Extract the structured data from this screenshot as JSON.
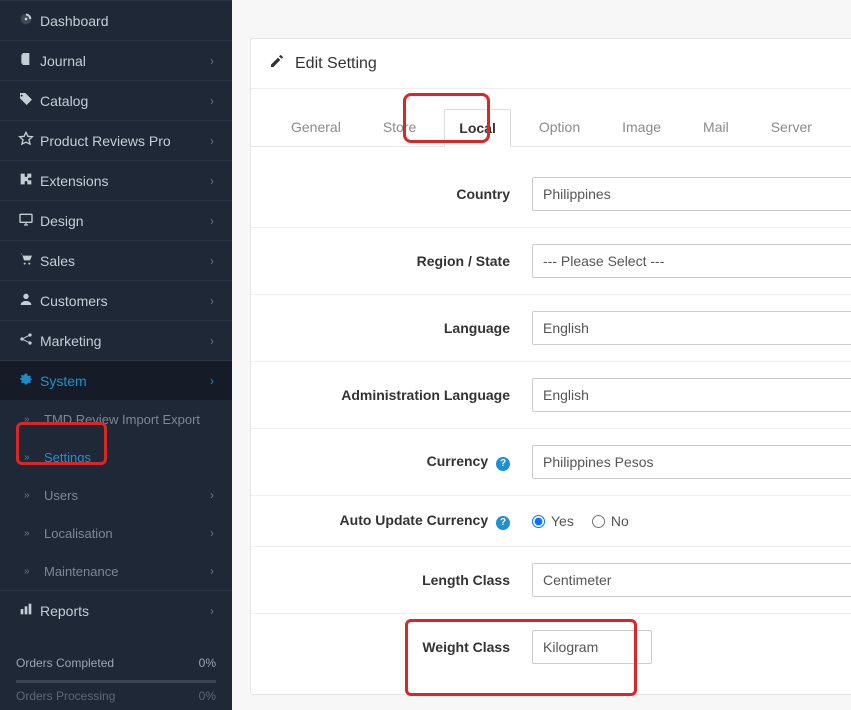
{
  "sidebar": {
    "items": [
      {
        "icon": "dashboard",
        "label": "Dashboard",
        "chevron": false
      },
      {
        "icon": "journal",
        "label": "Journal",
        "chevron": true
      },
      {
        "icon": "tag",
        "label": "Catalog",
        "chevron": true
      },
      {
        "icon": "star",
        "label": "Product Reviews Pro",
        "chevron": true
      },
      {
        "icon": "puzzle",
        "label": "Extensions",
        "chevron": true
      },
      {
        "icon": "monitor",
        "label": "Design",
        "chevron": true
      },
      {
        "icon": "cart",
        "label": "Sales",
        "chevron": true
      },
      {
        "icon": "user",
        "label": "Customers",
        "chevron": true
      },
      {
        "icon": "share",
        "label": "Marketing",
        "chevron": true
      },
      {
        "icon": "gear",
        "label": "System",
        "chevron": true,
        "active": true
      }
    ],
    "system_submenu": [
      {
        "label": "TMD Review Import Export",
        "chevron": false
      },
      {
        "label": "Settings",
        "chevron": false,
        "active": true
      },
      {
        "label": "Users",
        "chevron": true
      },
      {
        "label": "Localisation",
        "chevron": true
      },
      {
        "label": "Maintenance",
        "chevron": true
      }
    ],
    "last_item": {
      "icon": "reports",
      "label": "Reports",
      "chevron": true
    },
    "stats": [
      {
        "label": "Orders Completed",
        "value": "0%"
      },
      {
        "label": "Orders Processing",
        "value": "0%"
      }
    ]
  },
  "panel": {
    "title": "Edit Setting",
    "tabs": [
      {
        "label": "General"
      },
      {
        "label": "Store"
      },
      {
        "label": "Local",
        "active": true
      },
      {
        "label": "Option"
      },
      {
        "label": "Image"
      },
      {
        "label": "Mail"
      },
      {
        "label": "Server"
      }
    ],
    "fields": {
      "country_label": "Country",
      "country_value": "Philippines",
      "region_label": "Region / State",
      "region_value": "--- Please Select ---",
      "language_label": "Language",
      "language_value": "English",
      "admin_language_label": "Administration Language",
      "admin_language_value": "English",
      "currency_label": "Currency",
      "currency_value": "Philippines Pesos",
      "auto_update_label": "Auto Update Currency",
      "auto_update_yes": "Yes",
      "auto_update_no": "No",
      "length_label": "Length Class",
      "length_value": "Centimeter",
      "weight_label": "Weight Class",
      "weight_value": "Kilogram"
    }
  }
}
